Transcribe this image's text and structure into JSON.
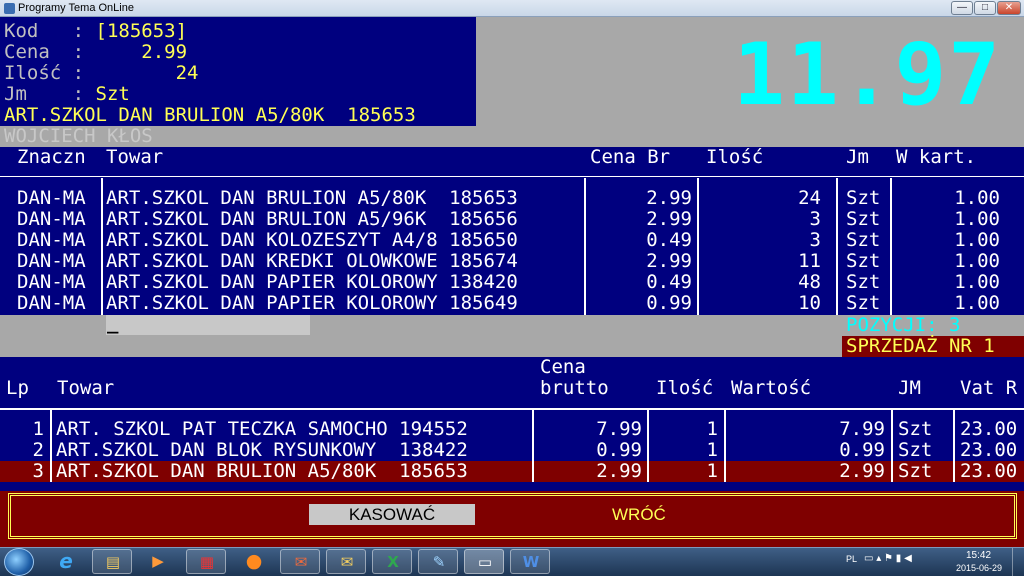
{
  "window": {
    "title": "Programy Tema OnLine",
    "buttons": {
      "minimize": "—",
      "maximize": "□",
      "close": "✕"
    }
  },
  "product_info": {
    "kod_label": "Kod   : ",
    "kod_value": "[185653]",
    "cena_label": "Cena  : ",
    "cena_value": "    2.99",
    "ilosc_label": "Ilość : ",
    "ilosc_value": "       24",
    "jm_label": "Jm    : ",
    "jm_value": "Szt",
    "name": "ART.SZKOL DAN BRULION A5/80K  185653"
  },
  "total_display": "11.97",
  "operator": "WOJCIECH KŁOS",
  "stock_table": {
    "headers": {
      "znaczn": "Znaczn",
      "towar": "Towar",
      "cena_br": "Cena Br",
      "ilosc": "Ilość",
      "jm": "Jm",
      "w_kart": "W kart."
    },
    "rows": [
      {
        "znaczn": "DAN-MA",
        "towar": "ART.SZKOL DAN BRULION A5/80K  185653",
        "cena": "2.99",
        "ilosc": "24",
        "jm": "Szt",
        "w_kart": "1.00"
      },
      {
        "znaczn": "DAN-MA",
        "towar": "ART.SZKOL DAN BRULION A5/96K  185656",
        "cena": "2.99",
        "ilosc": "3",
        "jm": "Szt",
        "w_kart": "1.00"
      },
      {
        "znaczn": "DAN-MA",
        "towar": "ART.SZKOL DAN KOLOZESZYT A4/8 185650",
        "cena": "0.49",
        "ilosc": "3",
        "jm": "Szt",
        "w_kart": "1.00"
      },
      {
        "znaczn": "DAN-MA",
        "towar": "ART.SZKOL DAN KREDKI OLOWKOWE 185674",
        "cena": "2.99",
        "ilosc": "11",
        "jm": "Szt",
        "w_kart": "1.00"
      },
      {
        "znaczn": "DAN-MA",
        "towar": "ART.SZKOL DAN PAPIER KOLOROWY 138420",
        "cena": "0.49",
        "ilosc": "48",
        "jm": "Szt",
        "w_kart": "1.00"
      },
      {
        "znaczn": "DAN-MA",
        "towar": "ART.SZKOL DAN PAPIER KOLOROWY 185649",
        "cena": "0.99",
        "ilosc": "10",
        "jm": "Szt",
        "w_kart": "1.00"
      }
    ]
  },
  "search_input": {
    "value": "_"
  },
  "pozycji": "POZYCJI: 3",
  "sprzedaz": "SPRZEDAŻ NR 1",
  "sale_table": {
    "headers": {
      "lp": "Lp",
      "towar": "Towar",
      "cena_line1": "Cena",
      "cena_line2": "brutto",
      "ilosc": "Ilość",
      "wartosc": "Wartość",
      "jm": "JM",
      "vat": "Vat R"
    },
    "rows": [
      {
        "lp": "1",
        "towar": "ART. SZKOL PAT TECZKA SAMOCHO 194552",
        "cena": "7.99",
        "ilosc": "1",
        "wartosc": "7.99",
        "jm": "Szt",
        "vat": "23.00"
      },
      {
        "lp": "2",
        "towar": "ART.SZKOL DAN BLOK RYSUNKOWY  138422",
        "cena": "0.99",
        "ilosc": "1",
        "wartosc": "0.99",
        "jm": "Szt",
        "vat": "23.00"
      },
      {
        "lp": "3",
        "towar": "ART.SZKOL DAN BRULION A5/80K  185653",
        "cena": "2.99",
        "ilosc": "1",
        "wartosc": "2.99",
        "jm": "Szt",
        "vat": "23.00"
      }
    ]
  },
  "actions": {
    "kasowac": "KASOWAĆ",
    "wroc": "WRÓĆ"
  },
  "taskbar": {
    "items": [
      {
        "icon": "internet-explorer-icon",
        "glyph": "e"
      },
      {
        "icon": "file-explorer-icon",
        "glyph": "▤"
      },
      {
        "icon": "media-player-icon",
        "glyph": "▶"
      },
      {
        "icon": "app-icon",
        "glyph": "▦"
      },
      {
        "icon": "firefox-icon",
        "glyph": "●"
      },
      {
        "icon": "outlook-icon",
        "glyph": "✉"
      },
      {
        "icon": "mail-icon",
        "glyph": "✉"
      },
      {
        "icon": "excel-icon",
        "glyph": "X"
      },
      {
        "icon": "paint-icon",
        "glyph": "✎"
      },
      {
        "icon": "console-icon",
        "glyph": "▭"
      },
      {
        "icon": "word-icon",
        "glyph": "W"
      }
    ],
    "language": "PL",
    "time": "15:42",
    "date": "2015-06-29"
  }
}
